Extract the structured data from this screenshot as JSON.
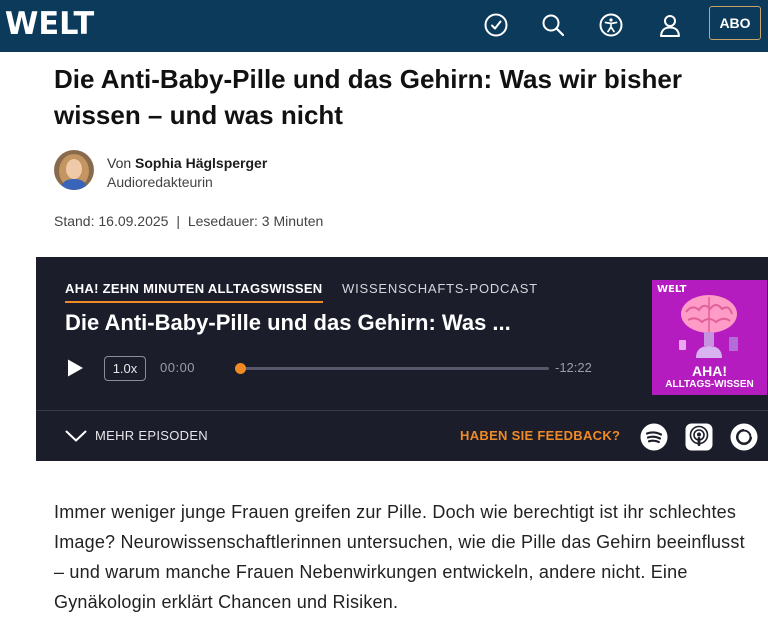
{
  "header": {
    "logo": "WELT",
    "abo_label": "ABO",
    "icons": [
      "clock-icon",
      "search-icon",
      "accessibility-icon",
      "user-icon"
    ],
    "bg_color": "#0b3a5b"
  },
  "article": {
    "title": "Die Anti-Baby-Pille und das Gehirn: Was wir bisher wissen – und was nicht",
    "author_prefix": "Von",
    "author_name": "Sophia Häglsperger",
    "author_role": "Audioredakteurin",
    "stand": "Stand: 16.09.2025",
    "separator": "|",
    "lesedauer": "Lesedauer: 3 Minuten",
    "lead": "Immer weniger junge Frauen greifen zur Pille. Doch wie berechtigt ist ihr schlechtes Image? Neurowissenschaftlerinnen untersuchen, wie die Pille das Gehirn beeinflusst – und warum manche Frauen Nebenwirkungen entwickeln, andere nicht. Eine Gynäkologin erklärt Chancen und Risiken."
  },
  "player": {
    "series": "AHA! ZEHN MINUTEN ALLTAGSWISSEN",
    "type": "WISSENSCHAFTS-PODCAST",
    "episode_title": "Die Anti-Baby-Pille und das Gehirn: Was ...",
    "speed": "1.0x",
    "elapsed": "00:00",
    "remaining": "-12:22",
    "progress": 0,
    "cover": {
      "logo": "WELT",
      "line1": "AHA!",
      "line2": "ALLTAGS-WISSEN",
      "bg_color": "#b51cc0"
    },
    "more_episodes": "MEHR EPISODEN",
    "feedback": "HABEN SIE FEEDBACK?",
    "services": [
      "spotify-icon",
      "apple-podcasts-icon",
      "amazon-music-icon"
    ],
    "accent_color": "#f08a24",
    "bg_color": "#1b1d2b"
  }
}
